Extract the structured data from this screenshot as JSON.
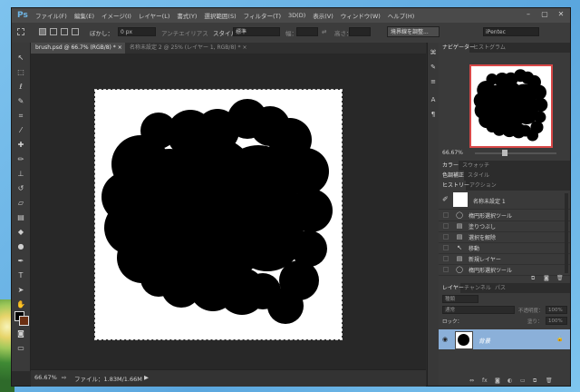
{
  "app": {
    "logo": "Ps"
  },
  "menu": [
    "ファイル(F)",
    "編集(E)",
    "イメージ(I)",
    "レイヤー(L)",
    "書式(Y)",
    "選択範囲(S)",
    "フィルター(T)",
    "3D(D)",
    "表示(V)",
    "ウィンドウ(W)",
    "ヘルプ(H)"
  ],
  "window_controls": {
    "minimize": "–",
    "maximize": "▢",
    "close": "✕"
  },
  "options": {
    "feather_label": "ぼかし：",
    "feather_value": "0 px",
    "antialias_label": "アンチエイリアス",
    "style_label": "スタイル：",
    "style_value": "標準",
    "width_label": "幅：",
    "height_label": "高さ：",
    "refine_button": "境界線を調整...",
    "workspace_value": "iPentec"
  },
  "doc_tabs": [
    {
      "label": "brush.psd @ 66.7% (RGB/8) *",
      "close": "×"
    },
    {
      "label": "名称未設定 2 @ 25% (レイヤー 1, RGB/8) *",
      "close": "×"
    }
  ],
  "status": {
    "zoom": "66.67%",
    "file_info": "ファイル：1.83M/1.66M"
  },
  "navigator": {
    "tabs": [
      "ナビゲーター",
      "ヒストグラム"
    ],
    "zoom": "66.67%"
  },
  "color_tabs": [
    "カラー",
    "スウォッチ"
  ],
  "adjust_tabs": [
    "色調補正",
    "スタイル"
  ],
  "history": {
    "tabs": [
      "ヒストリー",
      "アクション"
    ],
    "snapshot": "名称未設定 1",
    "items": [
      {
        "icon": "elliptical-marquee-icon",
        "label": "楕円形選択ツール"
      },
      {
        "icon": "document-icon",
        "label": "塗りつぶし"
      },
      {
        "icon": "document-icon",
        "label": "選択を解除"
      },
      {
        "icon": "move-icon",
        "label": "移動"
      },
      {
        "icon": "document-icon",
        "label": "新規レイヤー"
      },
      {
        "icon": "elliptical-marquee-icon",
        "label": "楕円形選択ツール"
      }
    ]
  },
  "layers": {
    "tabs": [
      "レイヤー",
      "チャンネル",
      "パス"
    ],
    "filter_label": "種類",
    "blend_mode": "通常",
    "opacity_label": "不透明度：",
    "opacity_value": "100%",
    "lock_label": "ロック：",
    "fill_label": "塗り：",
    "fill_value": "100%",
    "layer_name": "背景"
  },
  "colors": {
    "foreground": "#000000",
    "background": "#6b2f12",
    "selected_layer": "#8bb0d9",
    "navigator_frame": "#d84848"
  }
}
